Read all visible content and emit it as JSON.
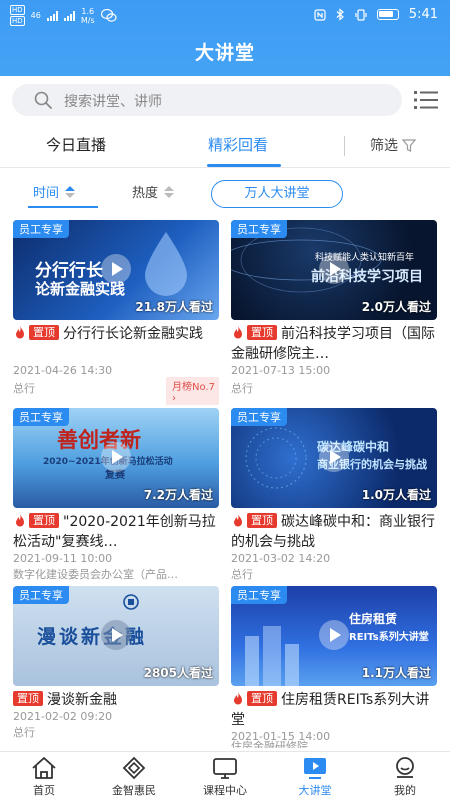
{
  "status_bar": {
    "left_badges": [
      "HD",
      "HD"
    ],
    "network": "46",
    "speed": "1.6",
    "speed_unit": "M/s",
    "time": "5:41"
  },
  "header": {
    "title": "大讲堂"
  },
  "search": {
    "placeholder": "搜索讲堂、讲师"
  },
  "tabs": {
    "live": "今日直播",
    "replay": "精彩回看",
    "filter": "筛选"
  },
  "sort": {
    "time": "时间",
    "heat": "热度",
    "chip": "万人大讲堂"
  },
  "cards": [
    {
      "badge": "员工专享",
      "thumb_line1": "分行行长",
      "thumb_line2": "论新金融实践",
      "views": "21.8万人看过",
      "pin": "置顶",
      "title": "分行行长论新金融实践",
      "date": "2021-04-26 14:30",
      "org": "总行",
      "rank": "月榜No.7 ›"
    },
    {
      "badge": "员工专享",
      "thumb_line1": "科技赋能人类认知新百年",
      "thumb_line2": "前沿科技学习项目",
      "views": "2.0万人看过",
      "pin": "置顶",
      "title": "前沿科技学习项目（国际金融研修院主…",
      "date": "2021-07-13 15:00",
      "org": "总行"
    },
    {
      "badge": "员工专享",
      "thumb_line1": "善创者新",
      "thumb_line2": "2020~2021年创新马拉松活动",
      "thumb_line3": "复赛",
      "views": "7.2万人看过",
      "pin": "置顶",
      "title": "\"2020-2021年创新马拉松活动\"复赛线…",
      "date": "2021-09-11 10:00",
      "org": "数字化建设委员会办公室（产品…"
    },
    {
      "badge": "员工专享",
      "thumb_line1": "碳达峰碳中和",
      "thumb_line2": "商业银行的机会与挑战",
      "views": "1.0万人看过",
      "pin": "置顶",
      "title": "碳达峰碳中和：商业银行的机会与挑战",
      "date": "2021-03-02 14:20",
      "org": "总行"
    },
    {
      "badge": "员工专享",
      "thumb_line1": "漫谈新金融",
      "views": "2805人看过",
      "pin": "置顶",
      "title": "漫谈新金融",
      "date": "2021-02-02 09:20",
      "org": "总行"
    },
    {
      "badge": "员工专享",
      "thumb_line1": "住房租赁",
      "thumb_line2": "REITs系列大讲堂",
      "views": "1.1万人看过",
      "pin": "置顶",
      "title": "住房租赁REITs系列大讲堂",
      "date": "2021-01-15 14:00",
      "org": "住房金融研修院"
    }
  ],
  "bottom_nav": [
    {
      "label": "首页",
      "icon": "home-icon"
    },
    {
      "label": "金智惠民",
      "icon": "knot-icon"
    },
    {
      "label": "课程中心",
      "icon": "monitor-icon"
    },
    {
      "label": "大讲堂",
      "icon": "play-screen-icon"
    },
    {
      "label": "我的",
      "icon": "profile-icon"
    }
  ],
  "colors": {
    "primary": "#2c8bf0",
    "pin_red": "#e63a2e",
    "header_blue": "#3e9bf4"
  }
}
